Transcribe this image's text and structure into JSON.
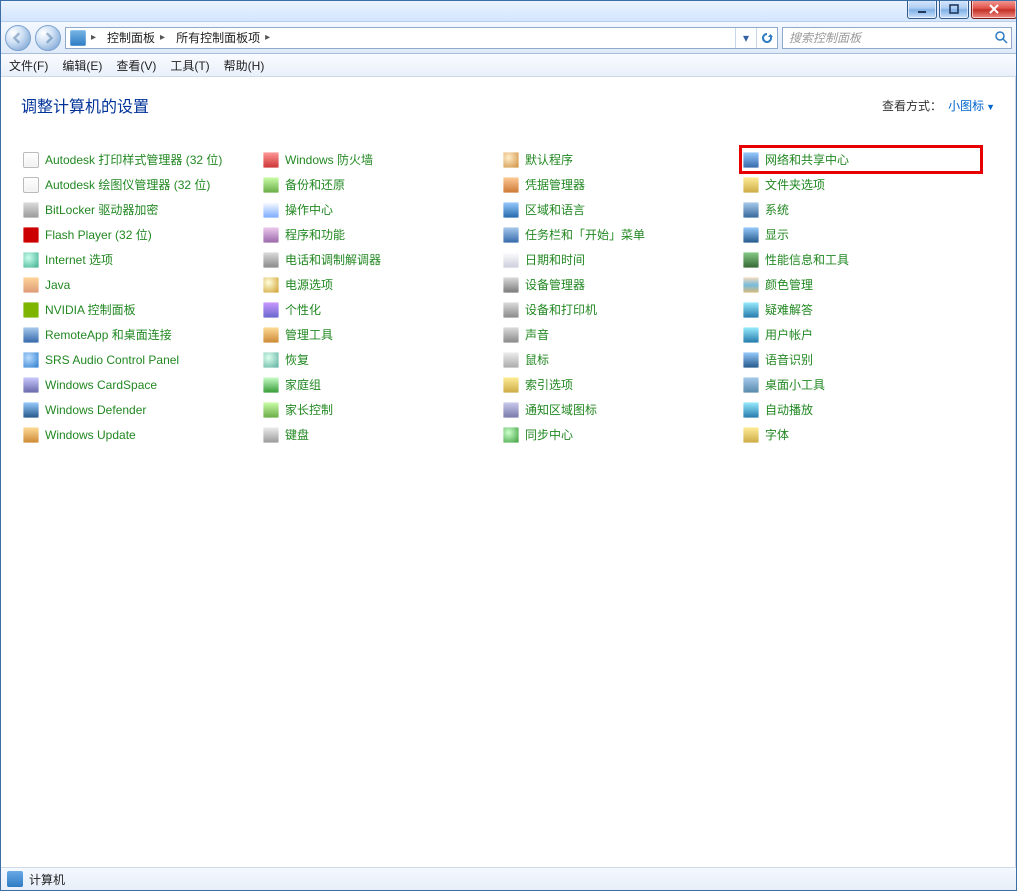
{
  "window_controls": {
    "minimize": "minimize",
    "maximize": "maximize",
    "close": "close"
  },
  "breadcrumb": {
    "segments": [
      "控制面板",
      "所有控制面板项"
    ]
  },
  "search": {
    "placeholder": "搜索控制面板"
  },
  "menu": {
    "file": "文件(F)",
    "edit": "编辑(E)",
    "view": "查看(V)",
    "tools": "工具(T)",
    "help": "帮助(H)"
  },
  "page_title": "调整计算机的设置",
  "view_by_label": "查看方式：",
  "view_by_value": "小图标",
  "items": [
    {
      "label": "Autodesk 打印样式管理器 (32 位)",
      "icon": "ic-file",
      "highlight": false
    },
    {
      "label": "Autodesk 绘图仪管理器 (32 位)",
      "icon": "ic-file",
      "highlight": false
    },
    {
      "label": "BitLocker 驱动器加密",
      "icon": "ic-bitlocker",
      "highlight": false
    },
    {
      "label": "Flash Player (32 位)",
      "icon": "ic-flash",
      "highlight": false
    },
    {
      "label": "Internet 选项",
      "icon": "ic-globe",
      "highlight": false
    },
    {
      "label": "Java",
      "icon": "ic-java",
      "highlight": false
    },
    {
      "label": "NVIDIA 控制面板",
      "icon": "ic-nvidia",
      "highlight": false
    },
    {
      "label": "RemoteApp 和桌面连接",
      "icon": "ic-remote",
      "highlight": false
    },
    {
      "label": "SRS Audio Control Panel",
      "icon": "ic-audio",
      "highlight": false
    },
    {
      "label": "Windows CardSpace",
      "icon": "ic-card",
      "highlight": false
    },
    {
      "label": "Windows Defender",
      "icon": "ic-defender",
      "highlight": false
    },
    {
      "label": "Windows Update",
      "icon": "ic-update",
      "highlight": false
    },
    {
      "label": "Windows 防火墙",
      "icon": "ic-shield",
      "highlight": false
    },
    {
      "label": "备份和还原",
      "icon": "ic-backup",
      "highlight": false
    },
    {
      "label": "操作中心",
      "icon": "ic-action",
      "highlight": false
    },
    {
      "label": "程序和功能",
      "icon": "ic-progf",
      "highlight": false
    },
    {
      "label": "电话和调制解调器",
      "icon": "ic-phone",
      "highlight": false
    },
    {
      "label": "电源选项",
      "icon": "ic-power",
      "highlight": false
    },
    {
      "label": "个性化",
      "icon": "ic-personal",
      "highlight": false
    },
    {
      "label": "管理工具",
      "icon": "ic-admin",
      "highlight": false
    },
    {
      "label": "恢复",
      "icon": "ic-recover",
      "highlight": false
    },
    {
      "label": "家庭组",
      "icon": "ic-home",
      "highlight": false
    },
    {
      "label": "家长控制",
      "icon": "ic-parent",
      "highlight": false
    },
    {
      "label": "键盘",
      "icon": "ic-keyboard",
      "highlight": false
    },
    {
      "label": "默认程序",
      "icon": "ic-prog",
      "highlight": false
    },
    {
      "label": "凭据管理器",
      "icon": "ic-cred",
      "highlight": false
    },
    {
      "label": "区域和语言",
      "icon": "ic-region",
      "highlight": false
    },
    {
      "label": "任务栏和「开始」菜单",
      "icon": "ic-taskbar",
      "highlight": false
    },
    {
      "label": "日期和时间",
      "icon": "ic-date",
      "highlight": false
    },
    {
      "label": "设备管理器",
      "icon": "ic-dev",
      "highlight": false
    },
    {
      "label": "设备和打印机",
      "icon": "ic-printer",
      "highlight": false
    },
    {
      "label": "声音",
      "icon": "ic-sound",
      "highlight": false
    },
    {
      "label": "鼠标",
      "icon": "ic-mouse",
      "highlight": false
    },
    {
      "label": "索引选项",
      "icon": "ic-index",
      "highlight": false
    },
    {
      "label": "通知区域图标",
      "icon": "ic-tray",
      "highlight": false
    },
    {
      "label": "同步中心",
      "icon": "ic-sync",
      "highlight": false
    },
    {
      "label": "网络和共享中心",
      "icon": "ic-net",
      "highlight": true
    },
    {
      "label": "文件夹选项",
      "icon": "ic-folderopt",
      "highlight": false
    },
    {
      "label": "系统",
      "icon": "ic-system",
      "highlight": false
    },
    {
      "label": "显示",
      "icon": "ic-display",
      "highlight": false
    },
    {
      "label": "性能信息和工具",
      "icon": "ic-perf",
      "highlight": false
    },
    {
      "label": "颜色管理",
      "icon": "ic-color",
      "highlight": false
    },
    {
      "label": "疑难解答",
      "icon": "ic-trouble",
      "highlight": false
    },
    {
      "label": "用户帐户",
      "icon": "ic-user",
      "highlight": false
    },
    {
      "label": "语音识别",
      "icon": "ic-speech",
      "highlight": false
    },
    {
      "label": "桌面小工具",
      "icon": "ic-gadget",
      "highlight": false
    },
    {
      "label": "自动播放",
      "icon": "ic-autoplay",
      "highlight": false
    },
    {
      "label": "字体",
      "icon": "ic-font",
      "highlight": false
    }
  ],
  "status": {
    "text": "计算机"
  }
}
